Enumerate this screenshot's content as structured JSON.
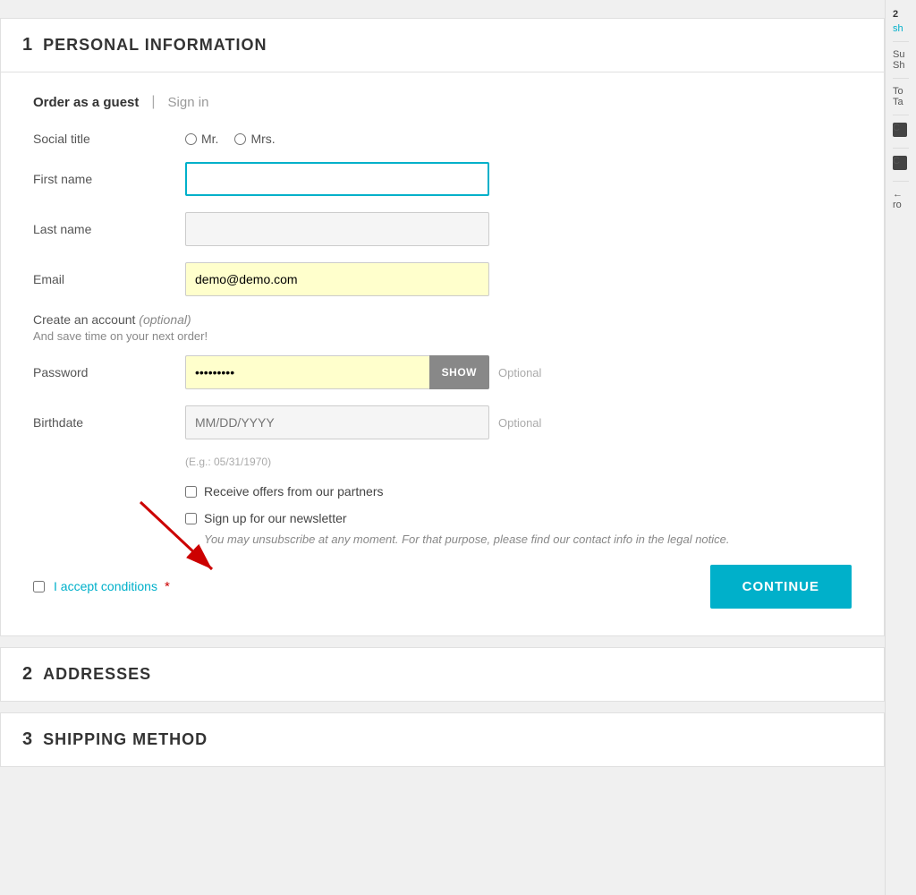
{
  "page": {
    "background": "#f0f0f0"
  },
  "section1": {
    "number": "1",
    "title": "PERSONAL INFORMATION",
    "guest_label": "Order as a guest",
    "pipe": "|",
    "sign_in": "Sign in",
    "social_title_label": "Social title",
    "radio_mr": "Mr.",
    "radio_mrs": "Mrs.",
    "firstname_label": "First name",
    "firstname_value": "",
    "lastname_label": "Last name",
    "lastname_value": "",
    "email_label": "Email",
    "email_value": "demo@demo.com",
    "create_account_title": "Create an account",
    "create_account_optional": "(optional)",
    "create_account_sub": "And save time on your next order!",
    "password_label": "Password",
    "password_value": "·········",
    "show_btn": "SHOW",
    "optional_text": "Optional",
    "birthdate_label": "Birthdate",
    "birthdate_placeholder": "MM/DD/YYYY",
    "birthdate_hint": "(E.g.: 05/31/1970)",
    "birthdate_optional": "Optional",
    "offers_label": "Receive offers from our partners",
    "newsletter_label": "Sign up for our newsletter",
    "newsletter_note": "You may unsubscribe at any moment. For that purpose, please find our contact info in the legal notice.",
    "accept_conditions_text": "I accept conditions",
    "accept_star": "*",
    "continue_btn": "CONTINUE"
  },
  "section2": {
    "number": "2",
    "title": "ADDRESSES"
  },
  "section3": {
    "number": "3",
    "title": "SHIPPING METHOD"
  },
  "sidebar": {
    "step2": "2",
    "step2_link": "sh",
    "summary_label": "Su",
    "shipping_short": "Sh",
    "total_label": "To",
    "tax_label": "Ta",
    "icon1": "C",
    "icon2": "C",
    "back_label": "← ro"
  }
}
